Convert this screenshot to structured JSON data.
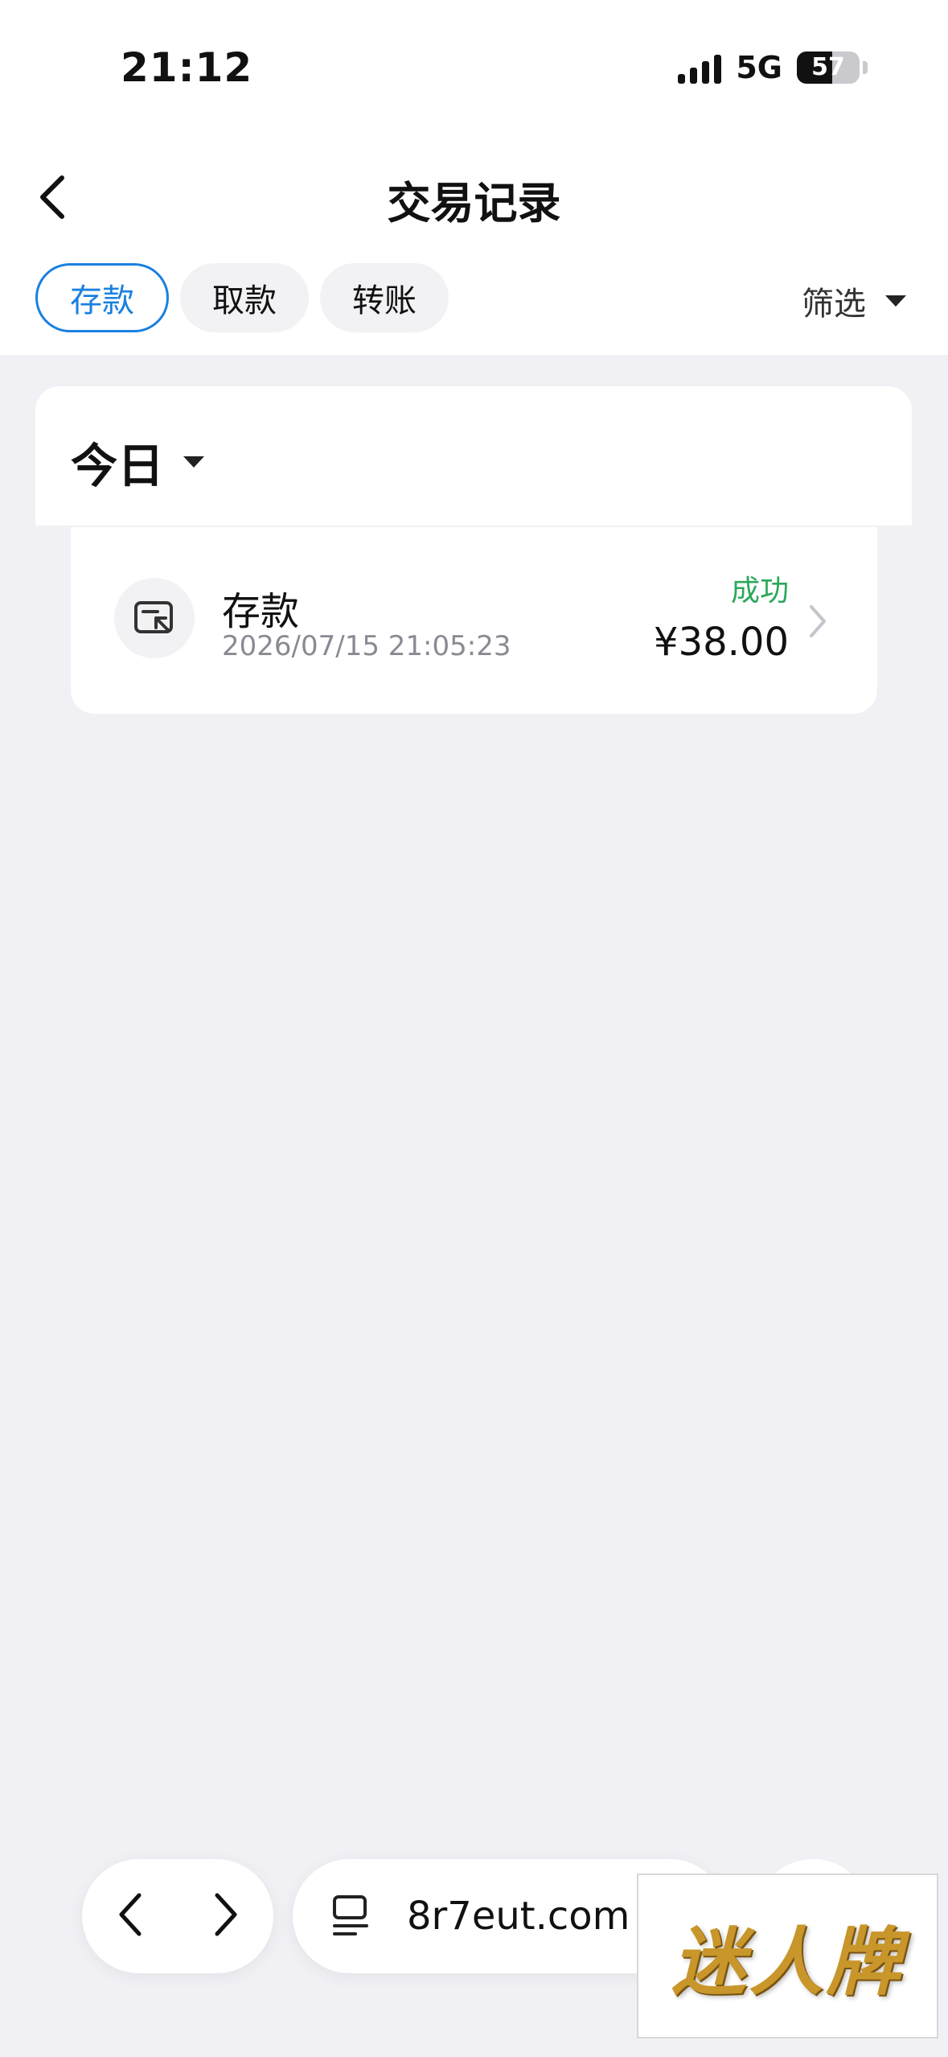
{
  "status_bar": {
    "time": "21:12",
    "network": "5G",
    "battery": "57"
  },
  "header": {
    "title": "交易记录"
  },
  "tabs": [
    {
      "label": "存款",
      "active": true
    },
    {
      "label": "取款",
      "active": false
    },
    {
      "label": "转账",
      "active": false
    }
  ],
  "filter": {
    "label": "筛选"
  },
  "date_group": {
    "label": "今日"
  },
  "transaction": {
    "title": "存款",
    "time": "2026/07/15 21:05:23",
    "status": "成功",
    "amount": "¥38.00"
  },
  "browser": {
    "url": "8r7eut.com"
  },
  "watermark": {
    "text": "迷人牌"
  },
  "colors": {
    "accent": "#1a80e0",
    "success": "#2aa85a",
    "background": "#f0f0f5"
  }
}
